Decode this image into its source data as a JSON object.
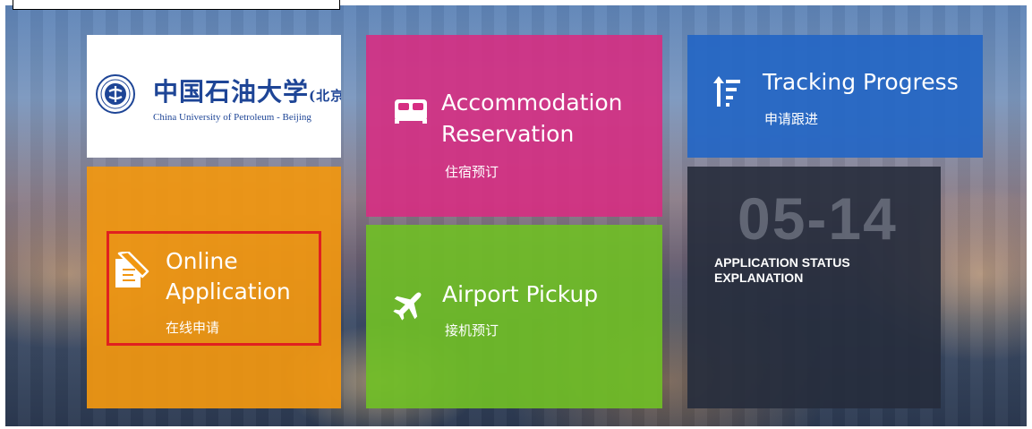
{
  "logo": {
    "name_cn": "中国石油大学",
    "suffix_cn": "(北京)",
    "name_en": "China University of Petroleum - Beijing"
  },
  "tiles": {
    "online_application": {
      "title_line1": "Online",
      "title_line2": "Application",
      "subtitle": "在线申请",
      "icon": "edit-document-icon",
      "color": "#f19710"
    },
    "accommodation": {
      "title_line1": "Accommodation",
      "title_line2": "Reservation",
      "subtitle": "住宿预订",
      "icon": "bed-icon",
      "color": "#d62d82"
    },
    "airport_pickup": {
      "title": "Airport Pickup",
      "subtitle": "接机预订",
      "icon": "airplane-icon",
      "color": "#70be26"
    },
    "tracking": {
      "title": "Tracking Progress",
      "subtitle": "申请跟进",
      "icon": "sort-arrow-icon",
      "color": "#2466c4"
    },
    "status": {
      "date": "05-14",
      "label_line1": "APPLICATION STATUS",
      "label_line2": "EXPLANATION",
      "color": "#262c3c"
    }
  },
  "highlight_color": "#e02020"
}
